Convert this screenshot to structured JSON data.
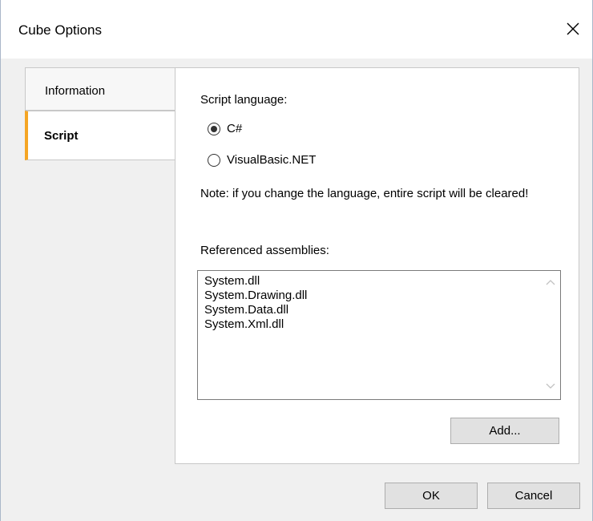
{
  "window": {
    "title": "Cube Options"
  },
  "tabs": [
    {
      "label": "Information"
    },
    {
      "label": "Script"
    }
  ],
  "script": {
    "language_label": "Script language:",
    "options": [
      {
        "label": "C#",
        "selected": true
      },
      {
        "label": "VisualBasic.NET",
        "selected": false
      }
    ],
    "note": "Note: if you change the language, entire script will be cleared!",
    "assemblies_label": "Referenced assemblies:",
    "assemblies": [
      "System.dll",
      "System.Drawing.dll",
      "System.Data.dll",
      "System.Xml.dll"
    ],
    "add_label": "Add..."
  },
  "footer": {
    "ok_label": "OK",
    "cancel_label": "Cancel"
  },
  "colors": {
    "tab_accent": "#f5a524",
    "button_bg": "#e1e1e1",
    "dialog_bg": "#f0f0f0"
  },
  "icons": {
    "close": "close-icon",
    "scroll_up": "scroll-up-arrow-icon",
    "scroll_down": "scroll-down-arrow-icon"
  }
}
